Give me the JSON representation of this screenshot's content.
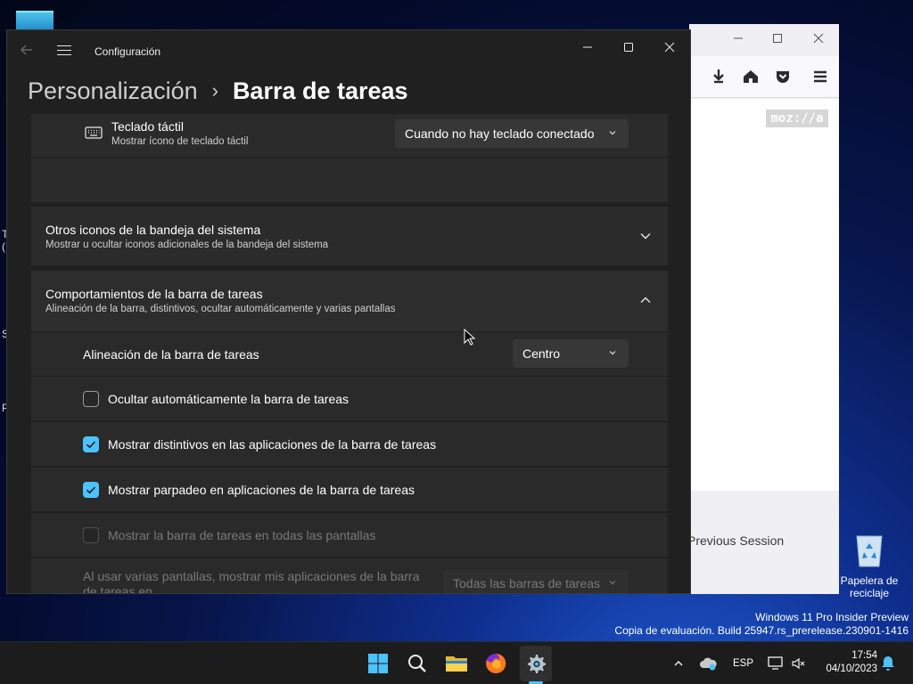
{
  "desktop": {
    "edge_texts": [
      "T",
      "(",
      "S",
      "P"
    ],
    "recycle_bin_label": "Papelera de reciclaje",
    "watermark": {
      "line1": "Windows 11 Pro Insider Preview",
      "line2": "Copia de evaluación. Build 25947.rs_prerelease.230901-1416"
    }
  },
  "firefox": {
    "logo": "moz://a",
    "previous_session": "Previous Session"
  },
  "settings": {
    "app_name": "Configuración",
    "breadcrumb": {
      "parent": "Personalización",
      "separator": "›",
      "current": "Barra de tareas"
    },
    "touch_keyboard": {
      "title": "Teclado táctil",
      "subtitle": "Mostrar ícono de teclado táctil",
      "dropdown_value": "Cuando no hay teclado conectado"
    },
    "other_tray_icons": {
      "title": "Otros iconos de la bandeja del sistema",
      "subtitle": "Mostrar u ocultar iconos adicionales de la bandeja del sistema"
    },
    "taskbar_behaviors": {
      "title": "Comportamientos de la barra de tareas",
      "subtitle": "Alineación de la barra, distintivos, ocultar automáticamente y varias pantallas",
      "alignment_label": "Alineación de la barra de tareas",
      "alignment_value": "Centro",
      "options": [
        {
          "label": "Ocultar automáticamente la barra de tareas",
          "checked": false,
          "enabled": true
        },
        {
          "label": "Mostrar distintivos en las aplicaciones de la barra de tareas",
          "checked": true,
          "enabled": true
        },
        {
          "label": "Mostrar parpadeo en aplicaciones de la barra de tareas",
          "checked": true,
          "enabled": true
        },
        {
          "label": "Mostrar la barra de tareas en todas las pantallas",
          "checked": false,
          "enabled": false
        }
      ],
      "multi_display_label": "Al usar varias pantallas, mostrar mis aplicaciones de la barra de tareas en",
      "multi_display_value": "Todas las barras de tareas"
    }
  },
  "taskbar": {
    "language": "ESP",
    "time": "17:54",
    "date": "04/10/2023"
  },
  "colors": {
    "accent": "#4cc2ff",
    "settings_bg": "#202020",
    "card_bg": "#2b2b2b"
  }
}
